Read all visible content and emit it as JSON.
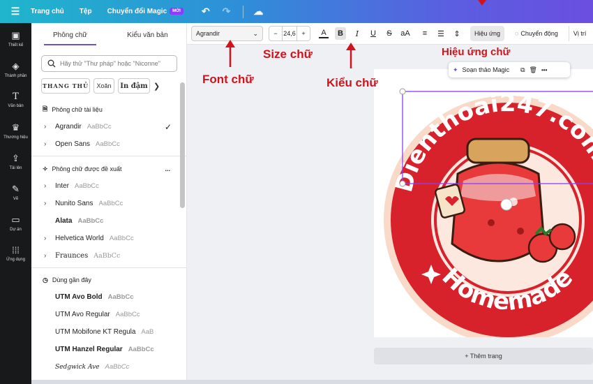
{
  "topbar": {
    "menu_icon": "hamburger-icon",
    "home": "Trang chủ",
    "file": "Tệp",
    "magic": "Chuyển đổi Magic",
    "badge": "MỚI",
    "undo_icon": "undo-icon",
    "redo_icon": "redo-icon",
    "cloud_icon": "cloud-check-icon"
  },
  "rail": [
    {
      "icon": "layout-icon",
      "label": "Thiết kế"
    },
    {
      "icon": "elements-icon",
      "label": "Thành phần"
    },
    {
      "icon": "text-icon",
      "label": "Văn bản"
    },
    {
      "icon": "brand-icon",
      "label": "Thương hiệu"
    },
    {
      "icon": "upload-icon",
      "label": "Tải lên"
    },
    {
      "icon": "draw-icon",
      "label": "Vẽ"
    },
    {
      "icon": "folder-icon",
      "label": "Dự án"
    },
    {
      "icon": "apps-icon",
      "label": "Ứng dụng"
    }
  ],
  "panel": {
    "tab_font": "Phông chữ",
    "tab_style": "Kiểu văn bản",
    "search_placeholder": "Hãy thử \"Thư pháp\" hoặc \"Niconne\"",
    "chips": [
      "THANG THỦ",
      "Xoăn",
      "In đậm"
    ],
    "doc_fonts_title": "Phông chữ tài liệu",
    "doc_fonts": [
      {
        "name": "Agrandir",
        "sample": "AaBbCc",
        "checked": true
      },
      {
        "name": "Open Sans",
        "sample": "AaBbCc"
      }
    ],
    "suggested_title": "Phông chữ được đề xuất",
    "suggested_more": "...",
    "suggested": [
      {
        "name": "Inter",
        "sample": "AaBbCc"
      },
      {
        "name": "Nunito Sans",
        "sample": "AaBbCc"
      },
      {
        "name": "Alata",
        "sample": "AaBbCc"
      },
      {
        "name": "Helvetica World",
        "sample": "AaBbCc"
      },
      {
        "name": "Fraunces",
        "sample": "AaBbCc"
      }
    ],
    "recent_title": "Dùng gần đây",
    "recent": [
      {
        "name": "UTM Avo Bold",
        "sample": "AaBbCc"
      },
      {
        "name": "UTM Avo Regular",
        "sample": "AaBbCc"
      },
      {
        "name": "UTM Mobifone KT Regula",
        "sample": "AaB"
      },
      {
        "name": "UTM Hanzel Regular",
        "sample": "AaBbCc"
      },
      {
        "name": "Sedgwick Ave",
        "sample": "AaBbCc"
      }
    ]
  },
  "toolbar": {
    "font": "Agrandir",
    "size": "24,6",
    "minus": "−",
    "plus": "+",
    "color_letter": "A",
    "bold": "B",
    "italic": "I",
    "underline": "U",
    "strike": "S",
    "case": "aA",
    "effects": "Hiệu ứng",
    "animate": "Chuyển động",
    "position": "Vị trí"
  },
  "context": {
    "magic_write": "Soạn thảo Magic",
    "more": "•••"
  },
  "design": {
    "arc_top": "Dienthoai247.com",
    "arc_bottom": "Homemade",
    "accent_red": "#d8222b",
    "peach": "#f9d9c8"
  },
  "add_page": "+ Thêm trang",
  "annotations": {
    "font": "Font chữ",
    "size": "Size chữ",
    "style": "Kiểu chữ",
    "effect": "Hiệu ứng chữ"
  }
}
